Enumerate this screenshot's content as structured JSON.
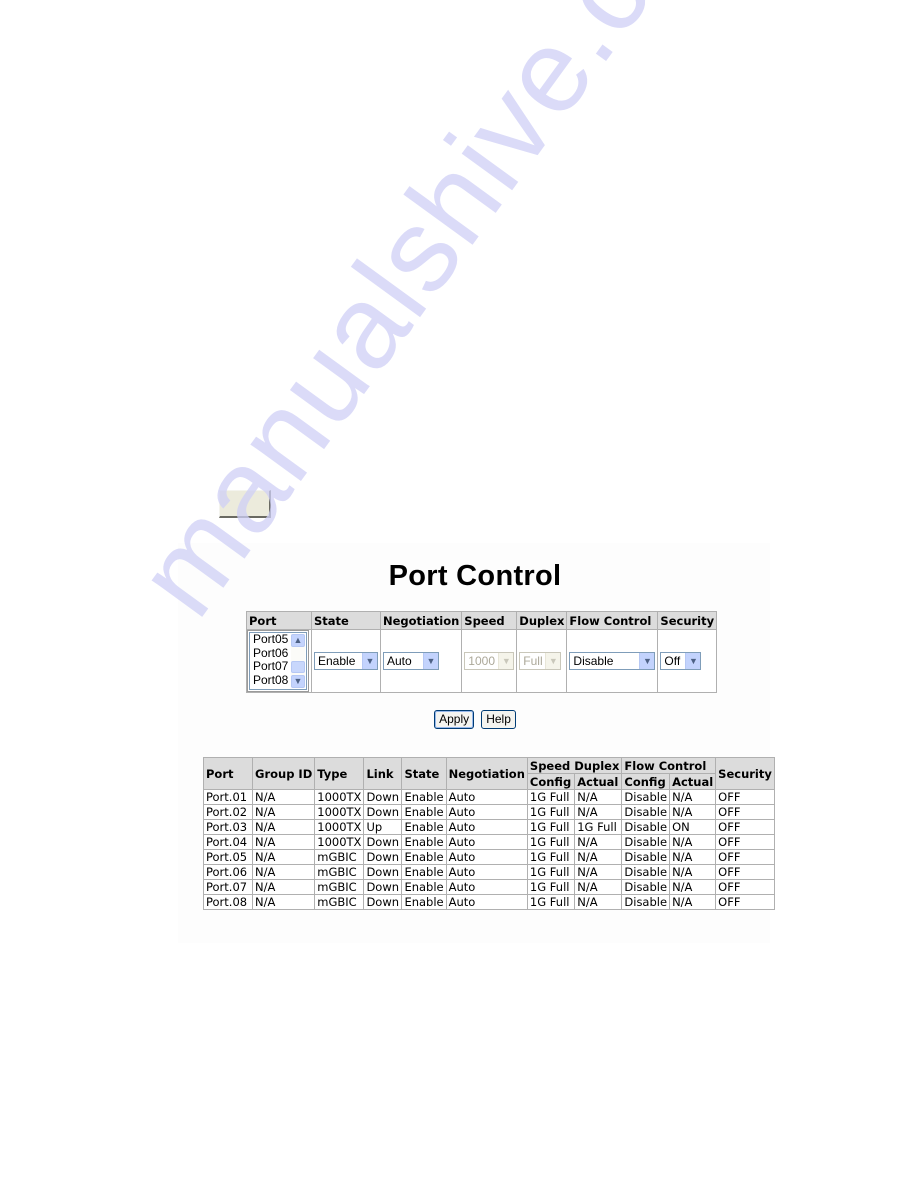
{
  "watermark": "manualshive.com",
  "page_title": "Port Control",
  "control_form": {
    "headers": [
      "Port",
      "State",
      "Negotiation",
      "Speed",
      "Duplex",
      "Flow Control",
      "Security"
    ],
    "port_list": {
      "options": [
        "Port05",
        "Port06",
        "Port07",
        "Port08"
      ]
    },
    "state": {
      "value": "Enable"
    },
    "negotiation": {
      "value": "Auto"
    },
    "speed": {
      "value": "1000",
      "disabled": true
    },
    "duplex": {
      "value": "Full",
      "disabled": true
    },
    "flow_control": {
      "value": "Disable"
    },
    "security": {
      "value": "Off"
    },
    "icons": {
      "dropdown": "chevron-down-icon",
      "scroll_up": "chevron-up-icon",
      "scroll_down": "chevron-down-icon"
    }
  },
  "buttons": {
    "apply": "Apply",
    "help": "Help"
  },
  "status_table": {
    "headers": {
      "port": "Port",
      "group_id": "Group ID",
      "type": "Type",
      "link": "Link",
      "state": "State",
      "negotiation": "Negotiation",
      "speed_duplex": "Speed Duplex",
      "flow_control": "Flow Control",
      "security": "Security",
      "config": "Config",
      "actual": "Actual"
    },
    "rows": [
      [
        "Port.01",
        "N/A",
        "1000TX",
        "Down",
        "Enable",
        "Auto",
        "1G Full",
        "N/A",
        "Disable",
        "N/A",
        "OFF"
      ],
      [
        "Port.02",
        "N/A",
        "1000TX",
        "Down",
        "Enable",
        "Auto",
        "1G Full",
        "N/A",
        "Disable",
        "N/A",
        "OFF"
      ],
      [
        "Port.03",
        "N/A",
        "1000TX",
        "Up",
        "Enable",
        "Auto",
        "1G Full",
        "1G Full",
        "Disable",
        "ON",
        "OFF"
      ],
      [
        "Port.04",
        "N/A",
        "1000TX",
        "Down",
        "Enable",
        "Auto",
        "1G Full",
        "N/A",
        "Disable",
        "N/A",
        "OFF"
      ],
      [
        "Port.05",
        "N/A",
        "mGBIC",
        "Down",
        "Enable",
        "Auto",
        "1G Full",
        "N/A",
        "Disable",
        "N/A",
        "OFF"
      ],
      [
        "Port.06",
        "N/A",
        "mGBIC",
        "Down",
        "Enable",
        "Auto",
        "1G Full",
        "N/A",
        "Disable",
        "N/A",
        "OFF"
      ],
      [
        "Port.07",
        "N/A",
        "mGBIC",
        "Down",
        "Enable",
        "Auto",
        "1G Full",
        "N/A",
        "Disable",
        "N/A",
        "OFF"
      ],
      [
        "Port.08",
        "N/A",
        "mGBIC",
        "Down",
        "Enable",
        "Auto",
        "1G Full",
        "N/A",
        "Disable",
        "N/A",
        "OFF"
      ]
    ]
  }
}
